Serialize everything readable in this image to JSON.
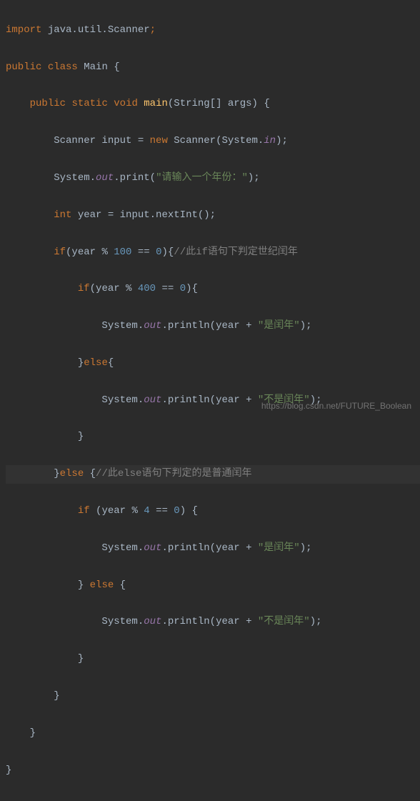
{
  "code": {
    "line1": {
      "import": "import",
      "pkg": " java.util.Scanner",
      "semi": ";"
    },
    "line2": {
      "public": "public",
      "class": "class",
      "name": "Main",
      "brace": " {"
    },
    "line3": {
      "public": "public",
      "static": "static",
      "void": "void",
      "main": "main",
      "params": "(String[] args) {"
    },
    "line4": {
      "type": "Scanner input = ",
      "new": "new",
      "ctor": " Scanner(System.",
      "in": "in",
      "end": ");"
    },
    "line5": {
      "sys": "System.",
      "out": "out",
      "print": ".print(",
      "str": "\"请输入一个年份：\"",
      "end": ");"
    },
    "line6": {
      "int": "int",
      "rest": " year = input.nextInt();"
    },
    "line7": {
      "if": "if",
      "cond": "(year % ",
      "n100": "100",
      "eq": " == ",
      "n0": "0",
      "brace": "){",
      "comment": "//此if语句下判定世纪闰年"
    },
    "line8": {
      "if": "if",
      "cond": "(year % ",
      "n400": "400",
      "eq": " == ",
      "n0": "0",
      "brace": "){"
    },
    "line9": {
      "sys": "System.",
      "out": "out",
      "print": ".println(year + ",
      "str": "\"是闰年\"",
      "end": ");"
    },
    "line10": {
      "close": "}",
      "else": "else",
      "brace": "{"
    },
    "line11": {
      "sys": "System.",
      "out": "out",
      "print": ".println(year + ",
      "str": "\"不是闰年\"",
      "end": ");"
    },
    "line12": {
      "close": "}"
    },
    "line13": {
      "close": "}",
      "else": "else",
      "brace": " {",
      "comment": "//此else语句下判定的是普通闰年"
    },
    "line14": {
      "if": "if",
      "cond": " (year % ",
      "n4": "4",
      "eq": " == ",
      "n0": "0",
      "brace": ") {"
    },
    "line15": {
      "sys": "System.",
      "out": "out",
      "print": ".println(year + ",
      "str": "\"是闰年\"",
      "end": ");"
    },
    "line16": {
      "close": "} ",
      "else": "else",
      "brace": " {"
    },
    "line17": {
      "sys": "System.",
      "out": "out",
      "print": ".println(year + ",
      "str": "\"不是闰年\"",
      "end": ");"
    },
    "line18": {
      "close": "}"
    },
    "line19": {
      "close": "}"
    },
    "line20": {
      "close": "}"
    },
    "line21": {
      "close": "}"
    }
  },
  "watermark": "https://blog.csdn.net/FUTURE_Boolean"
}
